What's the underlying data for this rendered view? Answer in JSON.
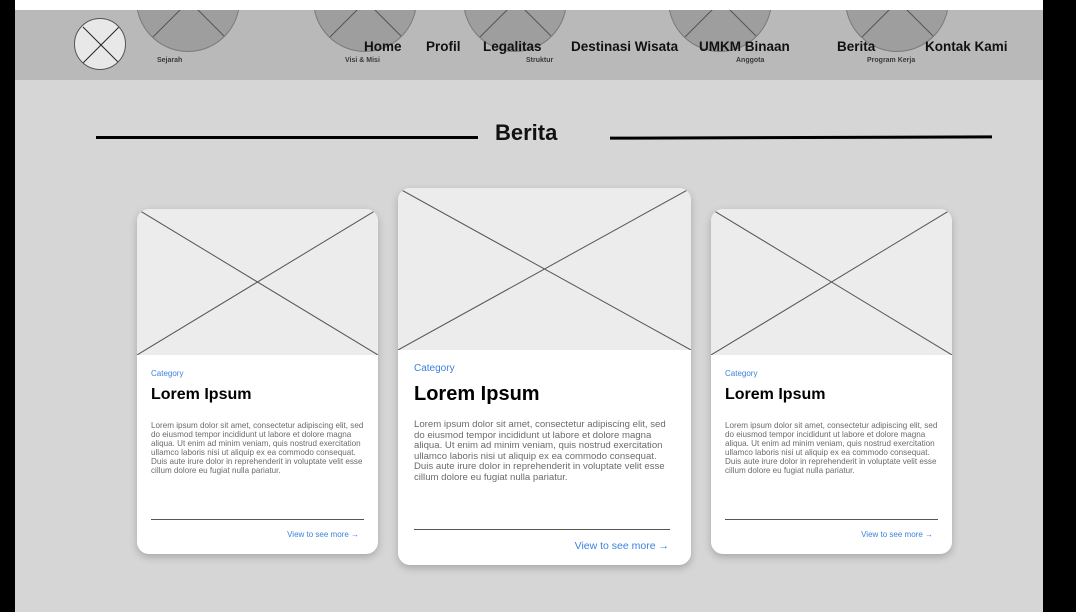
{
  "header": {
    "nav": [
      {
        "label": "Home"
      },
      {
        "label": "Profil"
      },
      {
        "label": "Legalitas"
      },
      {
        "label": "Destinasi Wisata"
      },
      {
        "label": "UMKM Binaan"
      },
      {
        "label": "Berita"
      },
      {
        "label": "Kontak Kami"
      }
    ],
    "sub_labels": [
      {
        "label": "Sejarah"
      },
      {
        "label": "Visi & Misi"
      },
      {
        "label": "Struktur"
      },
      {
        "label": "Anggota"
      },
      {
        "label": "Program Kerja"
      }
    ]
  },
  "section": {
    "title": "Berita"
  },
  "cards": [
    {
      "category": "Category",
      "title": "Lorem Ipsum",
      "body": "Lorem ipsum dolor sit amet, consectetur adipiscing elit, sed do eiusmod tempor incididunt ut labore et dolore magna aliqua. Ut enim ad minim veniam, quis nostrud exercitation ullamco laboris nisi ut aliquip ex ea commodo consequat. Duis aute irure dolor in reprehenderit in voluptate velit esse cillum dolore eu fugiat nulla pariatur.",
      "link": "View to see more →"
    },
    {
      "category": "Category",
      "title": "Lorem Ipsum",
      "body": "Lorem ipsum dolor sit amet, consectetur adipiscing elit, sed do eiusmod tempor incididunt ut labore et dolore magna aliqua. Ut enim ad minim veniam, quis nostrud exercitation ullamco laboris nisi ut aliquip ex ea commodo consequat. Duis aute irure dolor in reprehenderit in voluptate velit esse cillum dolore eu fugiat nulla pariatur.",
      "link": "View to see more →"
    },
    {
      "category": "Category",
      "title": "Lorem Ipsum",
      "body": "Lorem ipsum dolor sit amet, consectetur adipiscing elit, sed do eiusmod tempor incididunt ut labore et dolore magna aliqua. Ut enim ad minim veniam, quis nostrud exercitation ullamco laboris nisi ut aliquip ex ea commodo consequat. Duis aute irure dolor in reprehenderit in voluptate velit esse cillum dolore eu fugiat nulla pariatur.",
      "link": "View to see more →"
    }
  ],
  "colors": {
    "accent": "#3b82e0",
    "header_bg": "#b9b9b9",
    "page_bg": "#d6d6d6"
  },
  "icons": {
    "logo": "image-placeholder-icon",
    "card_image": "image-placeholder-icon"
  }
}
